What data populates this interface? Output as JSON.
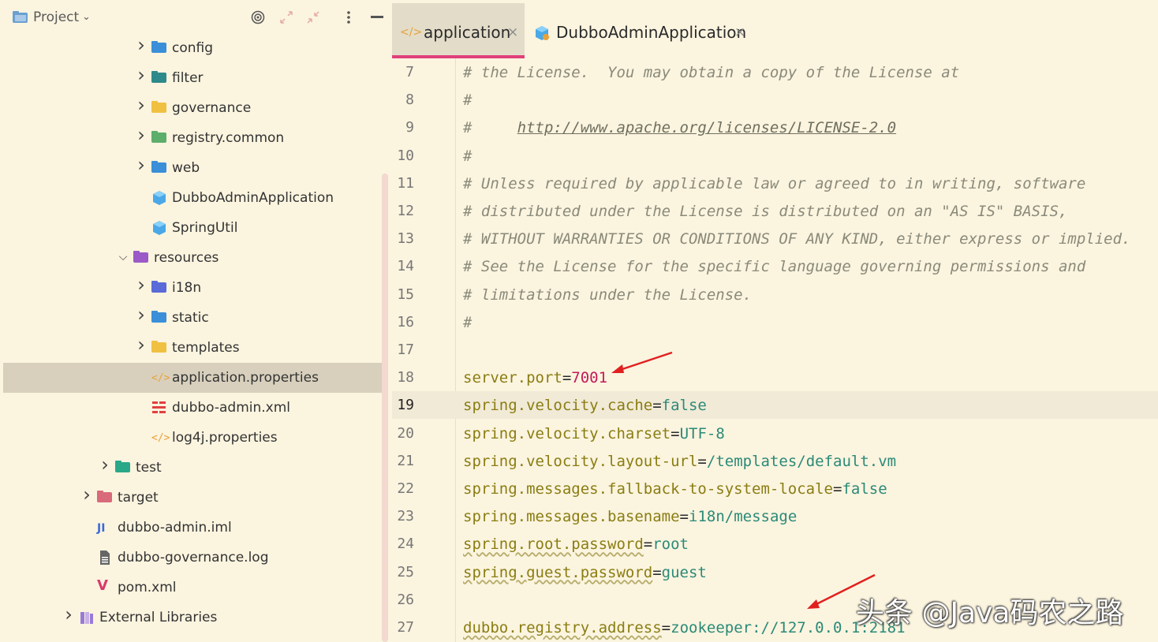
{
  "project_panel": {
    "title": "Project",
    "tree": [
      {
        "label": "config",
        "indent": 2,
        "expand": "collapsed",
        "icon": "folder-config-icon",
        "color": "#3a8fd8"
      },
      {
        "label": "filter",
        "indent": 2,
        "expand": "collapsed",
        "icon": "folder-filter-icon",
        "color": "#2e8a8a"
      },
      {
        "label": "governance",
        "indent": 2,
        "expand": "collapsed",
        "icon": "folder-governance-icon",
        "color": "#f0c040"
      },
      {
        "label": "registry.common",
        "indent": 2,
        "expand": "collapsed",
        "icon": "folder-registry-common-icon",
        "color": "#5cae6a"
      },
      {
        "label": "web",
        "indent": 2,
        "expand": "collapsed",
        "icon": "folder-web-icon",
        "color": "#3a8fd8"
      },
      {
        "label": "DubboAdminApplication",
        "indent": 2,
        "expand": "none",
        "icon": "class-icon",
        "color": "#4aa8e8"
      },
      {
        "label": "SpringUtil",
        "indent": 2,
        "expand": "none",
        "icon": "class-icon",
        "color": "#4aa8e8"
      },
      {
        "label": "resources",
        "indent": 1,
        "expand": "expanded",
        "icon": "resources-folder-icon",
        "color": "#9a5ac8"
      },
      {
        "label": "i18n",
        "indent": 2,
        "expand": "collapsed",
        "icon": "folder-i18n-icon",
        "color": "#5a6ad8"
      },
      {
        "label": "static",
        "indent": 2,
        "expand": "collapsed",
        "icon": "folder-static-icon",
        "color": "#3a8fd8"
      },
      {
        "label": "templates",
        "indent": 2,
        "expand": "collapsed",
        "icon": "folder-templates-icon",
        "color": "#f0c040"
      },
      {
        "label": "application.properties",
        "indent": 2,
        "expand": "none",
        "icon": "properties-file-icon",
        "color": "#e8a23a",
        "selected": true
      },
      {
        "label": "dubbo-admin.xml",
        "indent": 2,
        "expand": "none",
        "icon": "xml-file-icon",
        "color": "#e04040"
      },
      {
        "label": "log4j.properties",
        "indent": 2,
        "expand": "none",
        "icon": "properties-file-icon",
        "color": "#e8a23a"
      },
      {
        "label": "test",
        "indent": 0,
        "expand": "collapsed",
        "icon": "test-folder-icon",
        "color": "#2aa888"
      },
      {
        "label": "target",
        "indent": -1,
        "expand": "collapsed",
        "icon": "folder-target-icon",
        "color": "#d86a7a"
      },
      {
        "label": "dubbo-admin.iml",
        "indent": -1,
        "expand": "none",
        "icon": "iml-file-icon",
        "color": "#3a6ad8"
      },
      {
        "label": "dubbo-governance.log",
        "indent": -1,
        "expand": "none",
        "icon": "log-file-icon",
        "color": "#666666"
      },
      {
        "label": "pom.xml",
        "indent": -1,
        "expand": "none",
        "icon": "maven-icon",
        "color": "#d83a6a"
      },
      {
        "label": "External Libraries",
        "indent": -2,
        "expand": "collapsed",
        "icon": "libraries-icon",
        "color": "#9a7ad8"
      }
    ]
  },
  "tabs": [
    {
      "label": "application",
      "active": true,
      "icon": "properties-file-icon"
    },
    {
      "label": "DubboAdminApplication",
      "active": false,
      "icon": "class-icon"
    }
  ],
  "code_lines": [
    {
      "n": "7",
      "kind": "comment",
      "text": "# the License.  You may obtain a copy of the License at"
    },
    {
      "n": "8",
      "kind": "comment",
      "text": "#"
    },
    {
      "n": "9",
      "kind": "comment-url",
      "prefix": "#     ",
      "text": "http://www.apache.org/licenses/LICENSE-2.0"
    },
    {
      "n": "10",
      "kind": "comment",
      "text": "#"
    },
    {
      "n": "11",
      "kind": "comment",
      "text": "# Unless required by applicable law or agreed to in writing, software"
    },
    {
      "n": "12",
      "kind": "comment",
      "text": "# distributed under the License is distributed on an \"AS IS\" BASIS,"
    },
    {
      "n": "13",
      "kind": "comment",
      "text": "# WITHOUT WARRANTIES OR CONDITIONS OF ANY KIND, either express or implied."
    },
    {
      "n": "14",
      "kind": "comment",
      "text": "# See the License for the specific language governing permissions and"
    },
    {
      "n": "15",
      "kind": "comment",
      "text": "# limitations under the License."
    },
    {
      "n": "16",
      "kind": "comment",
      "text": "#"
    },
    {
      "n": "17",
      "kind": "blank",
      "text": ""
    },
    {
      "n": "18",
      "kind": "prop",
      "key": "server.port",
      "value": "7001",
      "numeric": true
    },
    {
      "n": "19",
      "kind": "prop",
      "key": "spring.velocity.cache",
      "value": "false",
      "current": true
    },
    {
      "n": "20",
      "kind": "prop",
      "key": "spring.velocity.charset",
      "value": "UTF-8"
    },
    {
      "n": "21",
      "kind": "prop",
      "key": "spring.velocity.layout-url",
      "value": "/templates/default.vm"
    },
    {
      "n": "22",
      "kind": "prop",
      "key": "spring.messages.fallback-to-system-locale",
      "value": "false"
    },
    {
      "n": "23",
      "kind": "prop",
      "key": "spring.messages.basename",
      "value": "i18n/message"
    },
    {
      "n": "24",
      "kind": "prop",
      "key": "spring.root.password",
      "value": "root",
      "underline": true
    },
    {
      "n": "25",
      "kind": "prop",
      "key": "spring.guest.password",
      "value": "guest",
      "underline": true
    },
    {
      "n": "26",
      "kind": "blank",
      "text": ""
    },
    {
      "n": "27",
      "kind": "prop",
      "key": "dubbo.registry.address",
      "value": "zookeeper://127.0.0.1:2181",
      "underline": true
    }
  ],
  "watermark": "头条 @Java码农之路",
  "colors": {
    "accent": "#e0407c",
    "annotation_arrow": "#e02020"
  }
}
